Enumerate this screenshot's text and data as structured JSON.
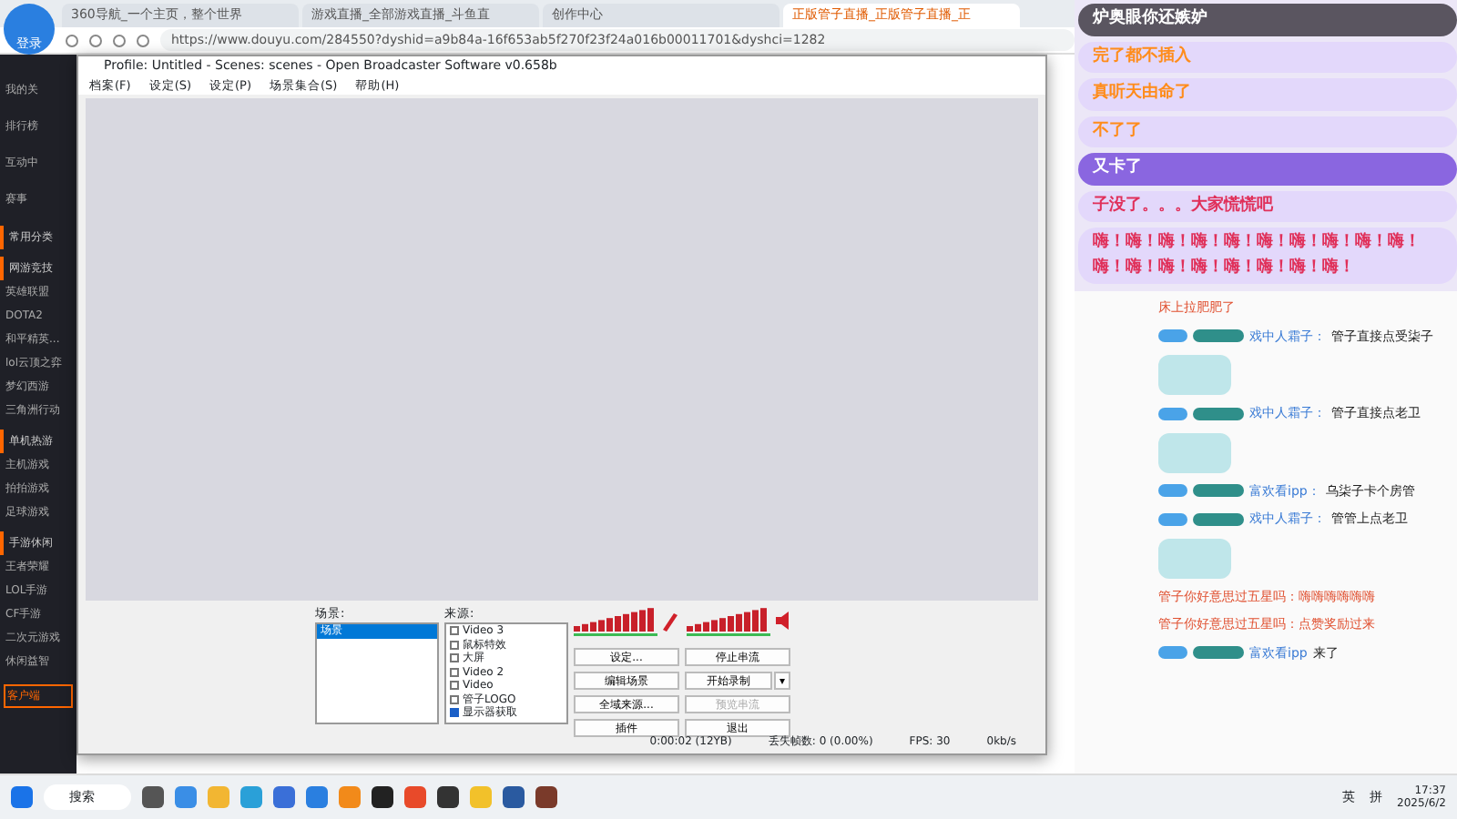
{
  "browser": {
    "tabs": [
      {
        "label": "360导航_一个主页，整个世界",
        "selected": false
      },
      {
        "label": "游戏直播_全部游戏直播_斗鱼直",
        "selected": false
      },
      {
        "label": "创作中心",
        "selected": false
      },
      {
        "label": "正版管子直播_正版管子直播_正",
        "selected": true
      }
    ],
    "login": "登录",
    "url": "https://www.douyu.com/284550?dyshid=a9b84a-16f653ab5f270f23f24a016b00011701&dyshci=1282"
  },
  "sidebar": {
    "items": [
      {
        "label": "我的关",
        "kind": "nav"
      },
      {
        "label": "排行榜",
        "kind": "nav"
      },
      {
        "label": "互动中",
        "kind": "nav"
      },
      {
        "label": "赛事",
        "kind": "nav"
      },
      {
        "label": "常用分类",
        "kind": "header"
      },
      {
        "label": "网游竞技",
        "kind": "header"
      },
      {
        "label": "英雄联盟",
        "kind": "game"
      },
      {
        "label": "DOTA2",
        "kind": "game"
      },
      {
        "label": "和平精英...",
        "kind": "game"
      },
      {
        "label": "lol云顶之弈",
        "kind": "game"
      },
      {
        "label": "梦幻西游",
        "kind": "game"
      },
      {
        "label": "三角洲行动",
        "kind": "game"
      },
      {
        "label": "单机热游",
        "kind": "header"
      },
      {
        "label": "主机游戏",
        "kind": "game"
      },
      {
        "label": "拍拍游戏",
        "kind": "game"
      },
      {
        "label": "足球游戏",
        "kind": "game"
      },
      {
        "label": "手游休闲",
        "kind": "header"
      },
      {
        "label": "王者荣耀",
        "kind": "game"
      },
      {
        "label": "LOL手游",
        "kind": "game"
      },
      {
        "label": "CF手游",
        "kind": "game"
      },
      {
        "label": "二次元游戏",
        "kind": "game"
      },
      {
        "label": "休闲益智",
        "kind": "game"
      }
    ],
    "client_button": "客户端"
  },
  "obs": {
    "title": "Profile: Untitled - Scenes: scenes - Open Broadcaster Software v0.658b",
    "menu": [
      "档案(F)",
      "设定(S)",
      "设定(P)",
      "场景集合(S)",
      "帮助(H)"
    ],
    "scenes_label": "场景:",
    "scenes": [
      {
        "label": "场景",
        "selected": true
      }
    ],
    "sources_label": "来源:",
    "sources": [
      {
        "label": "Video 3",
        "checked": false
      },
      {
        "label": "鼠标特效",
        "checked": false
      },
      {
        "label": "大屏",
        "checked": false
      },
      {
        "label": "Video 2",
        "checked": false
      },
      {
        "label": "Video",
        "checked": false
      },
      {
        "label": "管子LOGO",
        "checked": false
      },
      {
        "label": "显示器获取",
        "checked": true
      }
    ],
    "buttons": [
      {
        "label": "设定...",
        "disabled": false
      },
      {
        "label": "停止串流",
        "disabled": false
      },
      {
        "label": "编辑场景",
        "disabled": false
      },
      {
        "label": "开始录制",
        "disabled": false,
        "dropdown": "▾"
      },
      {
        "label": "全域来源...",
        "disabled": false
      },
      {
        "label": "预览串流",
        "disabled": true
      },
      {
        "label": "插件",
        "disabled": false
      },
      {
        "label": "退出",
        "disabled": false
      }
    ],
    "status": {
      "time": "0:00:02 (12YB)",
      "dropped": "丢失帧数: 0 (0.00%)",
      "fps": "FPS: 30",
      "bitrate": "0kb/s"
    }
  },
  "danmaku": [
    {
      "text": "炉奥眼你还嫉妒",
      "color": "#ffffff",
      "kind": "dark"
    },
    {
      "text": "完了都不插入",
      "color": "#ff8c1a",
      "kind": "purple"
    },
    {
      "text": "真听天由命了",
      "color": "#ff8c1a",
      "kind": "purple"
    },
    {
      "text": "不了了",
      "color": "#ff8c1a",
      "kind": "purple"
    },
    {
      "text": "又卡了",
      "color": "#ffffff",
      "kind": "purple"
    },
    {
      "text": "子没了。。。大家慌慌吧",
      "color": "#e0305a",
      "kind": "purple"
    },
    {
      "text": "嗨！嗨！嗨！嗨！嗨！嗨！嗨！嗨！嗨！嗨！嗨！嗨！嗨！嗨！嗨！嗨！嗨！嗨！",
      "color": "#e0305a",
      "kind": "purple"
    }
  ],
  "chat": [
    {
      "kind": "notice",
      "text": "床上拉肥肥了",
      "sticker": false
    },
    {
      "kind": "message",
      "user": "戏中人霜子：",
      "text": "管子直接点受柒子",
      "sticker": true
    },
    {
      "kind": "message",
      "user": "戏中人霜子：",
      "text": "管子直接点老卫",
      "sticker": true
    },
    {
      "kind": "message",
      "user": "富欢看ipp：",
      "text": "乌柒子卡个房管",
      "sticker": false
    },
    {
      "kind": "message",
      "user": "戏中人霜子：",
      "text": "管管上点老卫",
      "sticker": true
    },
    {
      "kind": "notice",
      "text": "管子你好意思过五星吗：嗨嗨嗨嗨嗨嗨",
      "sticker": false
    },
    {
      "kind": "notice",
      "text": "管子你好意思过五星吗：点赞奖励过来",
      "sticker": false
    },
    {
      "kind": "message",
      "user": "富欢看ipp",
      "text": "来了",
      "sticker": false
    }
  ],
  "taskbar": {
    "search": "搜索",
    "ime_lang": "英",
    "ime_mode": "拼",
    "time": "17:37",
    "date": "2025/6/2"
  }
}
